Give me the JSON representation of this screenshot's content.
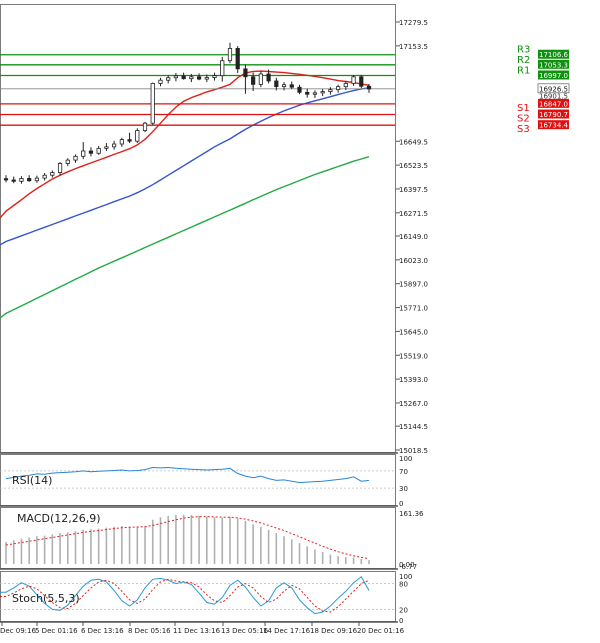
{
  "chart_data": [
    {
      "type": "candlestick",
      "title": "",
      "y_ticks": [
        17279.5,
        17153.5,
        16649.5,
        16523.5,
        16397.5,
        16271.5,
        16149.0,
        16023.0,
        15897.0,
        15771.0,
        15645.0,
        15519.0,
        15393.0,
        15267.0,
        15144.5,
        15018.5
      ],
      "ylim": [
        15018.5,
        17279.5
      ],
      "x_ticks": [
        "Dec 09:16",
        "5 Dec 01:16",
        "6 Dec 13:16",
        "8 Dec 05:16",
        "11 Dec 13:16",
        "13 Dec 05:16",
        "14 Dec 17:16",
        "18 Dec 09:16",
        "20 Dec 01:16"
      ],
      "candles": [
        {
          "o": 16452,
          "h": 16470,
          "l": 16432,
          "c": 16445
        },
        {
          "o": 16445,
          "h": 16463,
          "l": 16428,
          "c": 16438
        },
        {
          "o": 16438,
          "h": 16465,
          "l": 16425,
          "c": 16453
        },
        {
          "o": 16453,
          "h": 16470,
          "l": 16435,
          "c": 16441
        },
        {
          "o": 16441,
          "h": 16468,
          "l": 16430,
          "c": 16455
        },
        {
          "o": 16455,
          "h": 16482,
          "l": 16442,
          "c": 16470
        },
        {
          "o": 16470,
          "h": 16495,
          "l": 16458,
          "c": 16484
        },
        {
          "o": 16484,
          "h": 16540,
          "l": 16470,
          "c": 16532
        },
        {
          "o": 16532,
          "h": 16560,
          "l": 16518,
          "c": 16550
        },
        {
          "o": 16550,
          "h": 16580,
          "l": 16536,
          "c": 16570
        },
        {
          "o": 16570,
          "h": 16645,
          "l": 16555,
          "c": 16598
        },
        {
          "o": 16598,
          "h": 16618,
          "l": 16570,
          "c": 16586
        },
        {
          "o": 16586,
          "h": 16625,
          "l": 16578,
          "c": 16612
        },
        {
          "o": 16612,
          "h": 16640,
          "l": 16598,
          "c": 16620
        },
        {
          "o": 16620,
          "h": 16652,
          "l": 16605,
          "c": 16635
        },
        {
          "o": 16635,
          "h": 16668,
          "l": 16620,
          "c": 16658
        },
        {
          "o": 16658,
          "h": 16695,
          "l": 16640,
          "c": 16650
        },
        {
          "o": 16650,
          "h": 16718,
          "l": 16640,
          "c": 16706
        },
        {
          "o": 16706,
          "h": 16752,
          "l": 16698,
          "c": 16745
        },
        {
          "o": 16745,
          "h": 16960,
          "l": 16735,
          "c": 16955
        },
        {
          "o": 16955,
          "h": 16985,
          "l": 16940,
          "c": 16972
        },
        {
          "o": 16972,
          "h": 16998,
          "l": 16955,
          "c": 16985
        },
        {
          "o": 16985,
          "h": 17010,
          "l": 16966,
          "c": 16995
        },
        {
          "o": 16995,
          "h": 17012,
          "l": 16975,
          "c": 16980
        },
        {
          "o": 16980,
          "h": 17005,
          "l": 16962,
          "c": 16990
        },
        {
          "o": 16990,
          "h": 17008,
          "l": 16972,
          "c": 16978
        },
        {
          "o": 16978,
          "h": 17002,
          "l": 16962,
          "c": 16986
        },
        {
          "o": 16986,
          "h": 17012,
          "l": 16970,
          "c": 16996
        },
        {
          "o": 16996,
          "h": 17095,
          "l": 16965,
          "c": 17075
        },
        {
          "o": 17075,
          "h": 17170,
          "l": 17062,
          "c": 17140
        },
        {
          "o": 17140,
          "h": 17152,
          "l": 17010,
          "c": 17032
        },
        {
          "o": 17032,
          "h": 17055,
          "l": 16900,
          "c": 16990
        },
        {
          "o": 16990,
          "h": 17012,
          "l": 16915,
          "c": 16950
        },
        {
          "o": 16950,
          "h": 17020,
          "l": 16935,
          "c": 17005
        },
        {
          "o": 17005,
          "h": 17028,
          "l": 16955,
          "c": 16968
        },
        {
          "o": 16968,
          "h": 16985,
          "l": 16918,
          "c": 16938
        },
        {
          "o": 16938,
          "h": 16962,
          "l": 16918,
          "c": 16948
        },
        {
          "o": 16948,
          "h": 16965,
          "l": 16925,
          "c": 16935
        },
        {
          "o": 16935,
          "h": 16948,
          "l": 16898,
          "c": 16908
        },
        {
          "o": 16908,
          "h": 16928,
          "l": 16880,
          "c": 16898
        },
        {
          "o": 16898,
          "h": 16918,
          "l": 16878,
          "c": 16905
        },
        {
          "o": 16905,
          "h": 16925,
          "l": 16888,
          "c": 16912
        },
        {
          "o": 16912,
          "h": 16935,
          "l": 16896,
          "c": 16922
        },
        {
          "o": 16922,
          "h": 16948,
          "l": 16906,
          "c": 16938
        },
        {
          "o": 16938,
          "h": 16968,
          "l": 16920,
          "c": 16955
        },
        {
          "o": 16955,
          "h": 16998,
          "l": 16942,
          "c": 16990
        },
        {
          "o": 16990,
          "h": 17000,
          "l": 16930,
          "c": 16940
        },
        {
          "o": 16940,
          "h": 16952,
          "l": 16905,
          "c": 16926
        }
      ],
      "moving_averages": [
        {
          "color": "#e0201a",
          "values": [
            16280,
            16310,
            16340,
            16372,
            16400,
            16425,
            16450,
            16470,
            16488,
            16505,
            16520,
            16535,
            16550,
            16565,
            16580,
            16595,
            16610,
            16630,
            16660,
            16700,
            16745,
            16790,
            16830,
            16860,
            16880,
            16895,
            16910,
            16922,
            16935,
            16950,
            16985,
            17010,
            17018,
            17020,
            17018,
            17015,
            17012,
            17008,
            17003,
            16998,
            16992,
            16985,
            16978,
            16970,
            16965,
            16960,
            16952,
            16945
          ]
        },
        {
          "color": "#3355cc",
          "values": [
            16120,
            16135,
            16150,
            16165,
            16180,
            16195,
            16210,
            16225,
            16240,
            16255,
            16270,
            16285,
            16300,
            16315,
            16330,
            16345,
            16360,
            16378,
            16398,
            16420,
            16445,
            16470,
            16495,
            16520,
            16545,
            16570,
            16595,
            16620,
            16642,
            16662,
            16688,
            16712,
            16735,
            16755,
            16775,
            16793,
            16810,
            16825,
            16840,
            16852,
            16863,
            16874,
            16885,
            16896,
            16907,
            16917,
            16926,
            16932
          ]
        },
        {
          "color": "#22aa44",
          "values": [
            15740,
            15760,
            15780,
            15800,
            15820,
            15840,
            15860,
            15880,
            15900,
            15920,
            15940,
            15960,
            15980,
            15998,
            16016,
            16034,
            16052,
            16070,
            16088,
            16106,
            16124,
            16142,
            16160,
            16178,
            16196,
            16214,
            16232,
            16250,
            16268,
            16286,
            16304,
            16322,
            16340,
            16358,
            16376,
            16394,
            16410,
            16426,
            16442,
            16458,
            16474,
            16488,
            16502,
            16516,
            16530,
            16544,
            16556,
            16568
          ]
        }
      ],
      "levels": [
        {
          "name": "R3",
          "value": 17106.6,
          "color": "#109010"
        },
        {
          "name": "R2",
          "value": 17053.3,
          "color": "#109010"
        },
        {
          "name": "R1",
          "value": 16997.0,
          "color": "#109010"
        },
        {
          "name": "S1",
          "value": 16847.0,
          "color": "#e01010"
        },
        {
          "name": "S2",
          "value": 16790.7,
          "color": "#e01010"
        },
        {
          "name": "S3",
          "value": 16734.4,
          "color": "#e01010"
        }
      ],
      "level_labels": [
        "17106.6",
        "17053.3",
        "16997.0",
        "16847.0",
        "16790.7",
        "16734.4"
      ],
      "current_price": "16926.5",
      "current_price_value": 16926.5,
      "extra_labels": [
        "16901.5"
      ]
    },
    {
      "type": "line",
      "title": "RSI(14)",
      "y_ticks": [
        "100",
        "70",
        "30",
        "0"
      ],
      "ylim": [
        0,
        100
      ],
      "values": [
        52,
        55,
        58,
        60,
        63,
        62,
        65,
        66,
        67,
        68,
        70,
        68,
        69,
        70,
        71,
        72,
        70,
        71,
        73,
        78,
        77,
        78,
        76,
        75,
        74,
        73,
        72,
        73,
        74,
        76,
        64,
        58,
        54,
        58,
        52,
        48,
        49,
        46,
        43,
        44,
        45,
        46,
        48,
        50,
        52,
        56,
        46,
        48
      ],
      "color": "#2a86d6"
    },
    {
      "type": "histogram",
      "title": "MACD(12,26,9)",
      "y_ticks": [
        "161.36",
        "0.00",
        "-6.77"
      ],
      "ylim": [
        -6.77,
        161.36
      ],
      "values": [
        70,
        75,
        80,
        84,
        88,
        90,
        94,
        98,
        100,
        104,
        108,
        110,
        112,
        115,
        118,
        120,
        118,
        116,
        120,
        140,
        148,
        152,
        155,
        156,
        155,
        153,
        150,
        148,
        146,
        150,
        144,
        136,
        126,
        118,
        108,
        98,
        88,
        78,
        66,
        56,
        46,
        38,
        30,
        25,
        22,
        21,
        16,
        12
      ],
      "signal": [
        60,
        64,
        68,
        72,
        76,
        80,
        84,
        88,
        92,
        96,
        100,
        103,
        106,
        109,
        112,
        115,
        116,
        117,
        118,
        122,
        128,
        134,
        140,
        145,
        148,
        150,
        150,
        149,
        148,
        148,
        146,
        142,
        136,
        130,
        122,
        114,
        106,
        96,
        86,
        76,
        66,
        56,
        47,
        39,
        32,
        26,
        21,
        17
      ],
      "bar_color": "#b0b0b0",
      "signal_color": "#e02020"
    },
    {
      "type": "line",
      "title": "Stoch(5,5,3)",
      "y_ticks": [
        "100",
        "80",
        "20",
        "0"
      ],
      "ylim": [
        0,
        100
      ],
      "series": [
        {
          "color": "#2a9ad6",
          "values": [
            60,
            70,
            82,
            74,
            54,
            34,
            20,
            18,
            30,
            52,
            74,
            88,
            90,
            84,
            64,
            40,
            28,
            42,
            70,
            90,
            92,
            88,
            80,
            84,
            78,
            58,
            36,
            32,
            48,
            76,
            88,
            72,
            48,
            28,
            40,
            70,
            82,
            70,
            42,
            24,
            10,
            14,
            28,
            46,
            62,
            82,
            96,
            64
          ]
        },
        {
          "color": "#e02020",
          "values": [
            50,
            58,
            68,
            74,
            68,
            52,
            36,
            24,
            22,
            34,
            52,
            70,
            84,
            88,
            80,
            62,
            42,
            34,
            44,
            66,
            84,
            90,
            86,
            84,
            82,
            72,
            54,
            40,
            36,
            52,
            72,
            80,
            70,
            50,
            36,
            44,
            62,
            76,
            68,
            48,
            28,
            16,
            14,
            26,
            44,
            62,
            80,
            88
          ]
        }
      ],
      "guides": [
        80,
        20
      ]
    }
  ]
}
